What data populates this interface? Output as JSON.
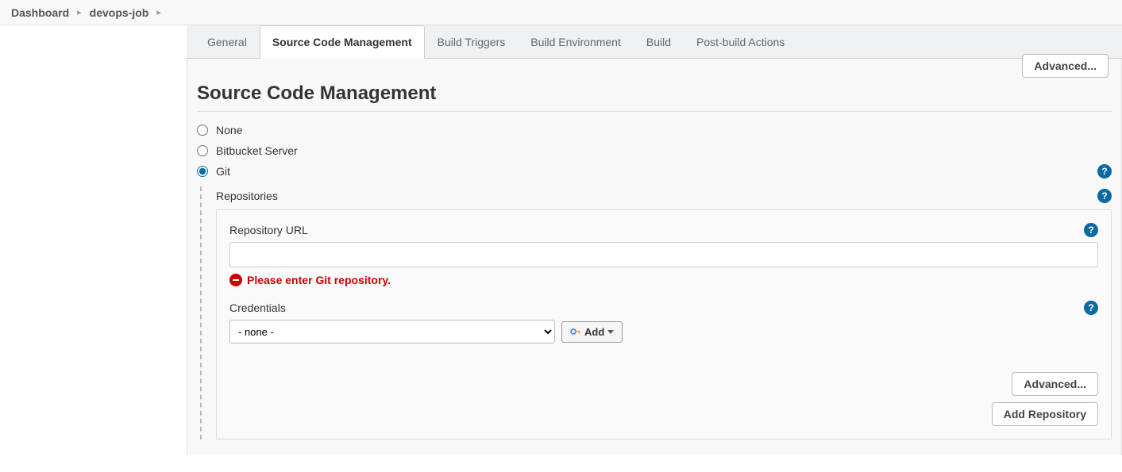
{
  "breadcrumbs": [
    {
      "label": "Dashboard"
    },
    {
      "label": "devops-job"
    }
  ],
  "tabs": {
    "general": "General",
    "scm": "Source Code Management",
    "triggers": "Build Triggers",
    "env": "Build Environment",
    "build": "Build",
    "post": "Post-build Actions"
  },
  "buttons": {
    "advanced_top": "Advanced...",
    "advanced": "Advanced...",
    "add_repo": "Add Repository",
    "add_cred": "Add"
  },
  "section": {
    "title": "Source Code Management"
  },
  "scm_options": {
    "none": "None",
    "bitbucket": "Bitbucket Server",
    "git": "Git"
  },
  "repo": {
    "section_label": "Repositories",
    "url_label": "Repository URL",
    "url_value": "",
    "error": "Please enter Git repository.",
    "credentials_label": "Credentials",
    "credentials_selected": "- none -"
  }
}
